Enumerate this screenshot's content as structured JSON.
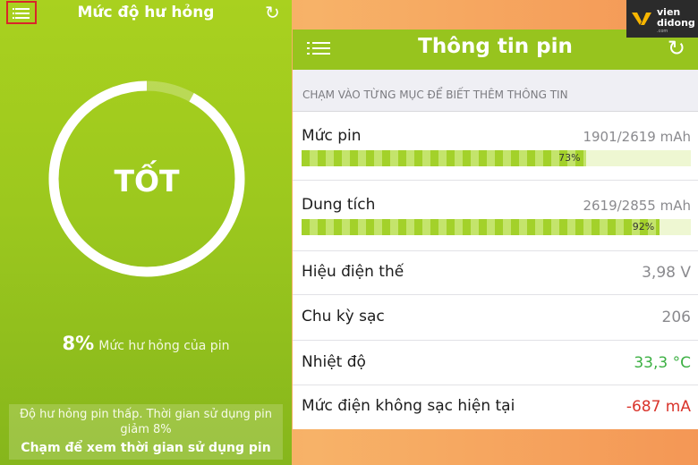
{
  "left": {
    "title": "Mức độ hư hỏng",
    "status": "TỐT",
    "damage_percent": "8%",
    "damage_label": "Mức hư hỏng của pin",
    "footer_line1": "Độ hư hỏng pin thấp. Thời gian sử dụng pin giảm 8%",
    "footer_action": "Chạm để xem thời gian sử dụng pin",
    "ring_fraction": 0.92,
    "highlight_color": "#d9262a"
  },
  "right": {
    "title": "Thông tin pin",
    "hint": "CHẠM VÀO TỪNG MỤC ĐỂ BIẾT THÊM THÔNG TIN",
    "level": {
      "label": "Mức pin",
      "value": "1901/2619 mAh",
      "percent_label": "73%",
      "fraction": 0.73
    },
    "capacity": {
      "label": "Dung tích",
      "value": "2619/2855 mAh",
      "percent_label": "92%",
      "fraction": 0.92
    },
    "voltage": {
      "label": "Hiệu điện thế",
      "value": "3,98 V"
    },
    "cycles": {
      "label": "Chu kỳ sạc",
      "value": "206"
    },
    "temperature": {
      "label": "Nhiệt độ",
      "value": "33,3 °C",
      "color": "#3cb043"
    },
    "current": {
      "label": "Mức điện không sạc hiện tại",
      "value": "-687 mA",
      "color": "#d9342b"
    }
  },
  "logo": {
    "line1": "vien",
    "line2": "didong",
    "line3": ".com"
  },
  "icons": {
    "menu": "menu-list-icon",
    "refresh": "refresh-icon",
    "logo": "logo-chevron-icon"
  }
}
